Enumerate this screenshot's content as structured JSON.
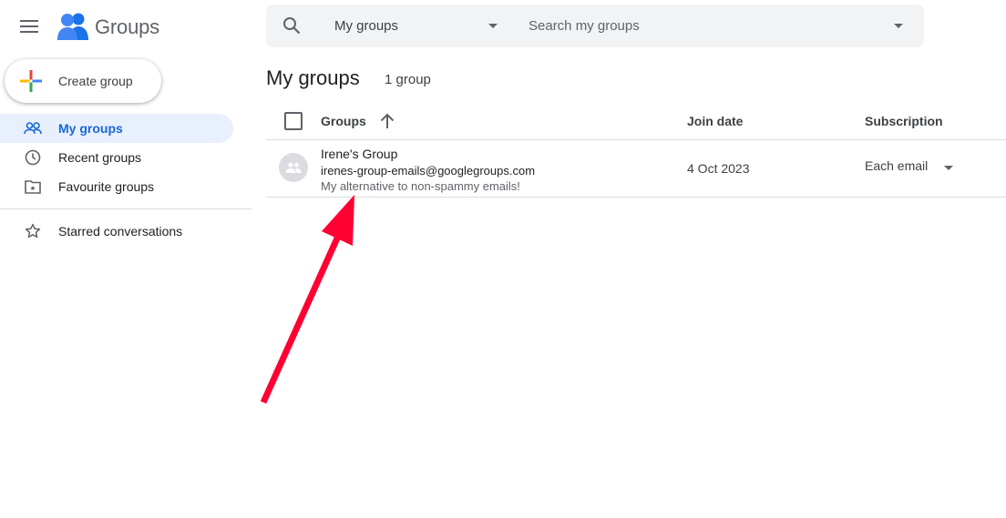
{
  "header": {
    "brand": "Groups",
    "menu_icon": "hamburger-menu-icon",
    "logo_icon": "groups-logo-icon"
  },
  "search": {
    "scope": "My groups",
    "placeholder": "Search my groups",
    "value": ""
  },
  "sidebar": {
    "create_label": "Create group",
    "items": [
      {
        "label": "My groups",
        "icon": "people-icon",
        "active": true
      },
      {
        "label": "Recent groups",
        "icon": "clock-icon",
        "active": false
      },
      {
        "label": "Favourite groups",
        "icon": "star-folder-icon",
        "active": false
      },
      {
        "label": "Starred conversations",
        "icon": "star-outline-icon",
        "active": false
      }
    ]
  },
  "main": {
    "title": "My groups",
    "count": "1 group",
    "columns": {
      "groups": "Groups",
      "join_date": "Join date",
      "subscription": "Subscription"
    },
    "rows": [
      {
        "name": "Irene's Group",
        "email": "irenes-group-emails@googlegroups.com",
        "description": "My alternative to non-spammy emails!",
        "join_date": "4 Oct 2023",
        "subscription": "Each email"
      }
    ]
  },
  "colors": {
    "accent": "#1967d2",
    "active_bg": "#e8f0fe",
    "annotation": "#ff0033",
    "logo_blue": "#4285f4",
    "logo_dark_blue": "#1a73e8"
  }
}
